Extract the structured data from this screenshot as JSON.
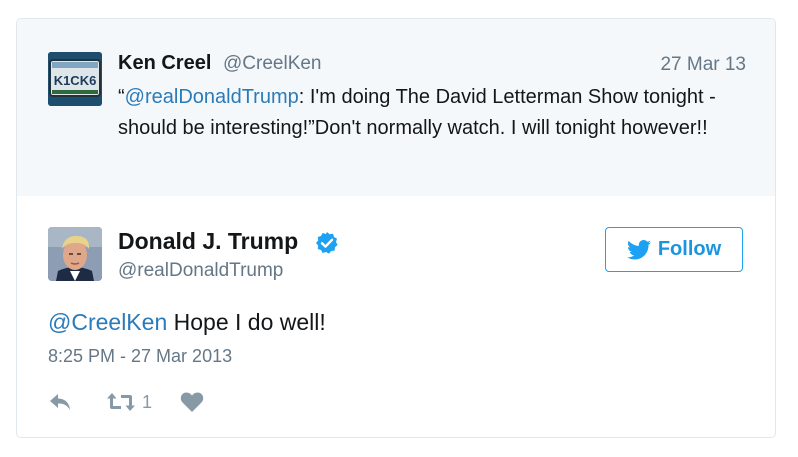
{
  "parent_tweet": {
    "name": "Ken Creel",
    "handle": "@CreelKen",
    "date": "27 Mar 13",
    "avatar_text": "K1CK6",
    "text_mention": "@realDonaldTrump",
    "text_open_quote": "“",
    "text_rest": ": I'm doing The David Letterman Show tonight -should be interesting!”Don't normally watch. I will tonight however!!"
  },
  "tweet": {
    "name": "Donald J. Trump",
    "handle": "@realDonaldTrump",
    "follow_label": "Follow",
    "mention": "@CreelKen",
    "text": " Hope I do well!",
    "timestamp": "8:25 PM - 27 Mar 2013",
    "retweet_count": "1"
  },
  "colors": {
    "link": "#2b7bb9",
    "follow_blue": "#1da1f2",
    "muted": "#657786",
    "parent_bg": "#f5f8fa"
  },
  "icons": {
    "reply": "reply-icon",
    "retweet": "retweet-icon",
    "like": "heart-icon",
    "verified": "verified-badge-icon",
    "follow_bird": "twitter-bird-icon"
  }
}
